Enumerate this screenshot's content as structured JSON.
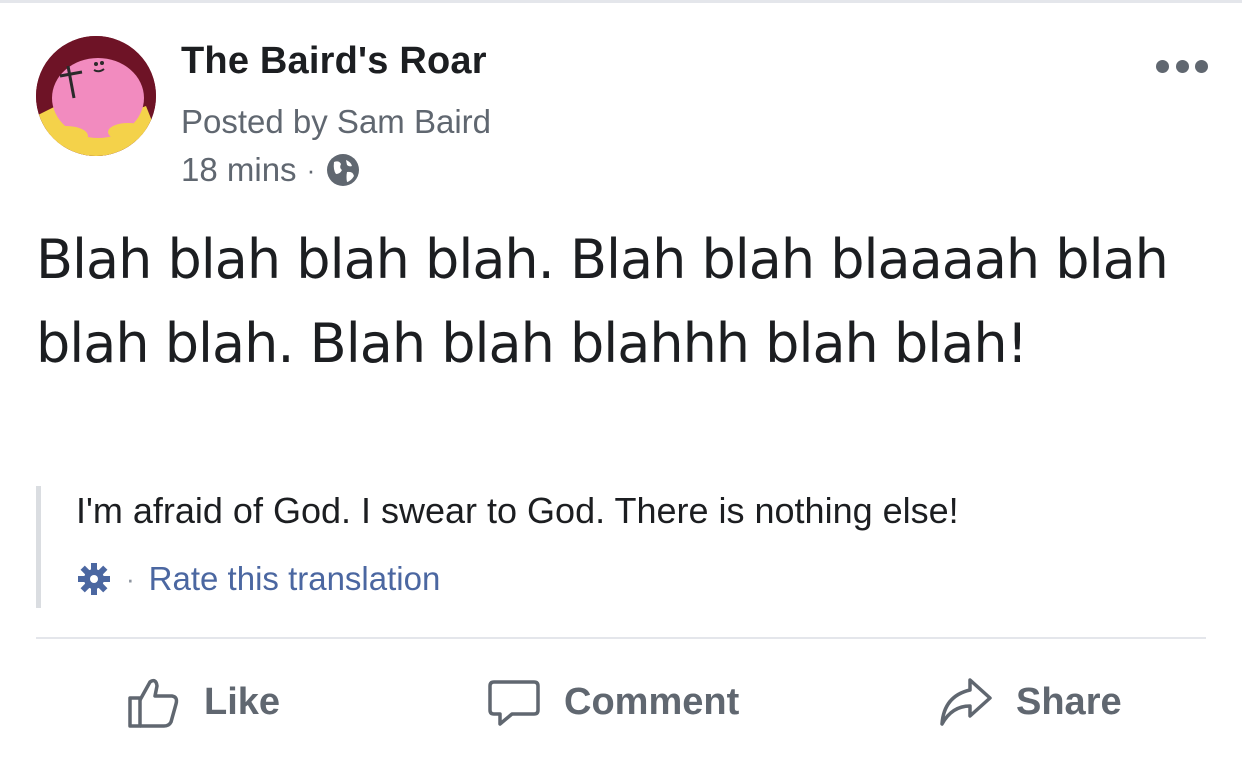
{
  "post": {
    "page_name": "The Baird's Roar",
    "posted_by": "Posted by Sam Baird",
    "time": "18 mins",
    "separator": "·",
    "body": "Blah blah blah blah. Blah blah blaaaah blah blah blah. Blah blah blahhh blah blah!",
    "translation": "I'm afraid of God. I swear to God. There is nothing else!",
    "rate_translation": "Rate this translation"
  },
  "actions": {
    "like": "Like",
    "comment": "Comment",
    "share": "Share"
  },
  "icons": {
    "avatar": "avatar-image",
    "more": "more-options-icon",
    "privacy": "globe-icon",
    "settings": "gear-icon",
    "like": "thumbs-up-icon",
    "comment": "comment-bubble-icon",
    "share": "share-arrow-icon"
  },
  "colors": {
    "text": "#1c1e21",
    "secondary": "#606770",
    "link": "#4b67a1",
    "divider": "#e4e6eb"
  }
}
